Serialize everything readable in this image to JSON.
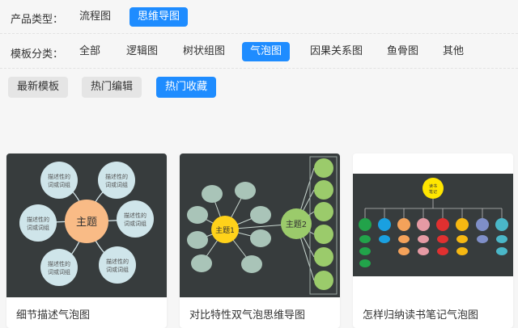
{
  "filters": {
    "product_type": {
      "label": "产品类型：",
      "options": [
        "流程图",
        "思维导图"
      ],
      "selected": "思维导图"
    },
    "template_category": {
      "label": "模板分类：",
      "options": [
        "全部",
        "逻辑图",
        "树状组图",
        "气泡图",
        "因果关系图",
        "鱼骨图",
        "其他"
      ],
      "selected": "气泡图"
    }
  },
  "sort_tabs": {
    "options": [
      "最新模板",
      "热门编辑",
      "热门收藏"
    ],
    "selected": "热门收藏"
  },
  "colors": {
    "accent": "#1e8cff",
    "thumb_dark_bg": "#373c3d",
    "bubble_center": "#f9bb86",
    "bubble_leaf": "#cfe5ea",
    "double_center_1": "#ffd21a",
    "double_center_2": "#9bcb6b",
    "double_leaf": "#a9c4b8",
    "notes_center": "#ffe600"
  },
  "cards": [
    {
      "title": "细节描述气泡图",
      "thumbnail": {
        "center": "主题",
        "bubbles": [
          "描述性的\n词或词组",
          "描述性的\n词或词组",
          "描述性的\n词或词组",
          "描述性的\n词或词组",
          "描述性的\n词或词组",
          "描述性的\n词或词组"
        ]
      }
    },
    {
      "title": "对比特性双气泡思维导图",
      "thumbnail": {
        "center_a": "主题1",
        "center_b": "主题2"
      }
    },
    {
      "title": "怎样归纳读书笔记气泡图",
      "thumbnail": {
        "center": "读书\n笔记"
      }
    }
  ]
}
